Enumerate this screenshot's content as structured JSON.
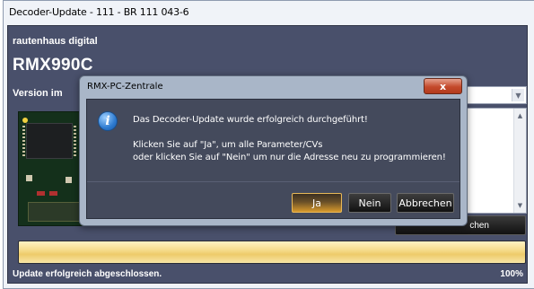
{
  "window": {
    "title": "Decoder-Update - 111 - BR 111 043-6"
  },
  "main": {
    "vendor": "rautenhaus digital",
    "product": "RMX990C",
    "version_label": "Version im",
    "background_button_label": "chen",
    "progress_fraction": 1.0,
    "status_text": "Update erfolgreich abgeschlossen.",
    "status_percent": "100%"
  },
  "dialog": {
    "title": "RMX-PC-Zentrale",
    "close_label": "x",
    "icon": "info-icon",
    "message_line1": "Das Decoder-Update wurde erfolgreich durchgeführt!",
    "message_line2": "Klicken Sie auf \"Ja\", um alle Parameter/CVs",
    "message_line3": "oder klicken Sie auf \"Nein\" um nur die Adresse neu zu programmieren!",
    "buttons": {
      "yes": "Ja",
      "no": "Nein",
      "cancel": "Abbrechen"
    }
  },
  "colors": {
    "frame": "#49506b",
    "dialog_inner": "#444a5c",
    "accent_gold": "#d89a2c",
    "progress_fill": "#f5dc8c"
  }
}
